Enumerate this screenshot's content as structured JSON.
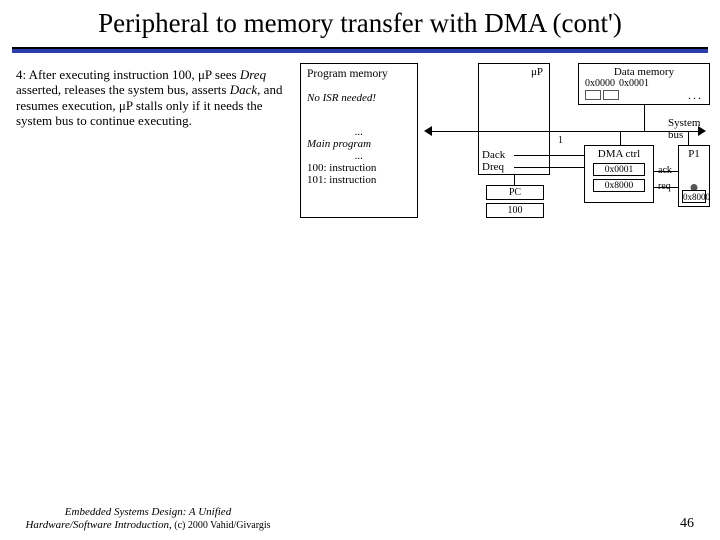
{
  "title": "Peripheral to memory transfer with DMA (cont')",
  "left_text": {
    "step_prefix": "4: After executing instruction 100, μP sees ",
    "word1": "Dreq",
    "mid1": " asserted, releases the system bus, asserts ",
    "word2": "Dack",
    "mid2": ", and resumes execution, μP stalls only if it needs the system bus to continue executing."
  },
  "program_memory": {
    "header": "Program memory",
    "no_isr": "No ISR needed!",
    "dots1": "...",
    "main": "Main program",
    "dots2": "...",
    "inst100": "100: instruction",
    "inst101": "101: instruction"
  },
  "microprocessor": {
    "label": "μP",
    "dack": "Dack",
    "dreq": "Dreq",
    "pc_label": "PC",
    "pc_value": "100"
  },
  "data_memory": {
    "header": "Data memory",
    "addr0": "0x0000",
    "addr1": "0x0001",
    "dots": "..."
  },
  "bus": {
    "label": "System bus",
    "one": "1"
  },
  "dma": {
    "header": "DMA ctrl",
    "reg1": "0x0001",
    "reg2": "0x8000",
    "ack": "ack",
    "req": "req"
  },
  "p1": {
    "header": "P1",
    "reg": "0x8000"
  },
  "footer": {
    "line1": "Embedded Systems Design: A Unified",
    "line2": "Hardware/Software Introduction,",
    "copyright": " (c) 2000 Vahid/Givargis",
    "page": "46"
  }
}
